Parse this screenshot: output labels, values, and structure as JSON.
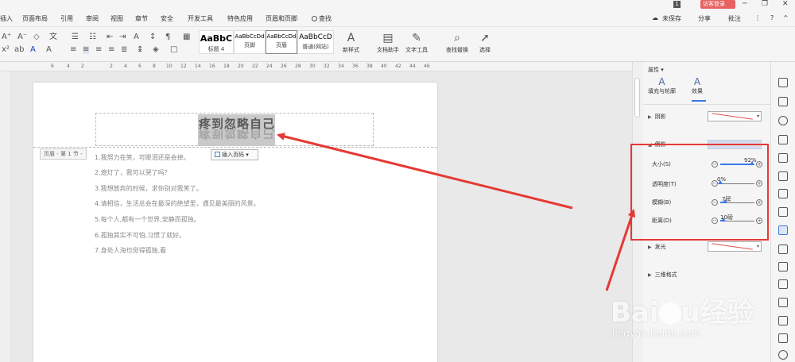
{
  "menubar": {
    "items": [
      "插入",
      "页面布局",
      "引用",
      "审阅",
      "视图",
      "章节",
      "安全",
      "开发工具",
      "特色应用",
      "页眉和页脚",
      "查找"
    ],
    "page_indicator": "1",
    "login": "访客登录",
    "right_actions": {
      "unsaved": "未保存",
      "share": "分享",
      "comment": "批注"
    }
  },
  "styles": [
    {
      "sample": "AaBbC",
      "name": "标题 4"
    },
    {
      "sample": "AaBbCcDd",
      "name": "页脚"
    },
    {
      "sample": "AaBbCcDd",
      "name": "页眉"
    },
    {
      "sample": "AaBbCcD",
      "name": "普通(网站)"
    }
  ],
  "toolbar_big": {
    "new_style": "新样式",
    "doc_helper": "文档助手",
    "text_tools": "文字工具",
    "find_replace": "查找替换",
    "select": "选择"
  },
  "ruler_numbers": [
    "6",
    "4",
    "2",
    "2",
    "4",
    "6",
    "8",
    "10",
    "12",
    "14",
    "16",
    "18",
    "20",
    "22",
    "24",
    "26",
    "28",
    "30",
    "32",
    "34",
    "36",
    "38",
    "40",
    "42",
    "44",
    "46"
  ],
  "document": {
    "header_text": "疼到忽略自己",
    "header_tag": "页眉 - 第 1 节 -",
    "insert_page_number": "插入页码",
    "lines": [
      "1.我努力在笑，可眼泪还是会掉。",
      "2.熄灯了，我可以哭了吗？",
      "3.我想放弃的时候，求你别对我笑了。",
      "4.请相信，生活总会在最深的绝望里，遇见最美丽的风景。",
      "5.每个人,都有一个世界,安静而孤独。",
      "6.孤独其实不可怕,习惯了就好。",
      "7.身处人海也觉得孤独,看"
    ]
  },
  "panel": {
    "title": "属性",
    "tabs": [
      {
        "label": "填充与轮廓"
      },
      {
        "label": "效果"
      }
    ],
    "sections": {
      "shadow": "阴影",
      "reflection": "倒影",
      "glow": "发光",
      "three_d": "三维格式"
    },
    "sliders": [
      {
        "label": "大小(S)",
        "value_text": "92%",
        "level": 0.92
      },
      {
        "label": "透明度(T)",
        "value_text": "0%",
        "level": 0.0
      },
      {
        "label": "模糊(B)",
        "value_text": "7磅",
        "level": 0.14
      },
      {
        "label": "距离(D)",
        "value_text": "10磅",
        "level": 0.1
      }
    ]
  },
  "watermark": {
    "logo": "Bai",
    "logo2": "u",
    "brand": "经验",
    "url": "jingyan.baidu.com"
  },
  "colors": {
    "accent": "#3b78e7",
    "annotation": "#e53935",
    "login": "#e86161"
  }
}
